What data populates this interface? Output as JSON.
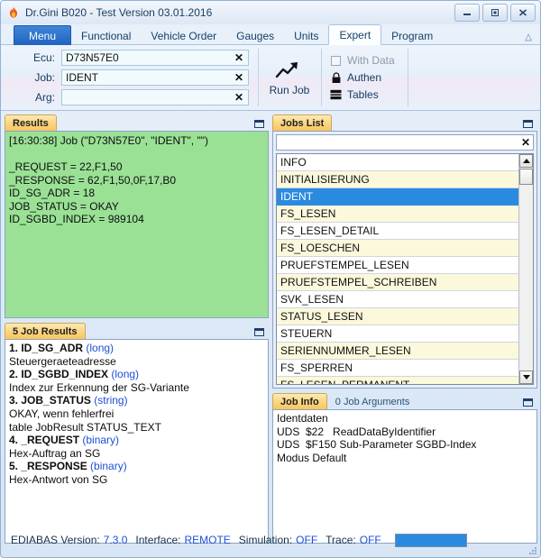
{
  "window": {
    "title": "Dr.Gini B020 - Test Version 03.01.2016",
    "icon": "flame-icon",
    "buttons": {
      "minimize": "minimize-icon",
      "maximize": "maximize-icon",
      "close": "close-icon"
    }
  },
  "ribbon": {
    "menu_label": "Menu",
    "tabs": [
      {
        "label": "Functional",
        "active": false
      },
      {
        "label": "Vehicle Order",
        "active": false
      },
      {
        "label": "Gauges",
        "active": false
      },
      {
        "label": "Units",
        "active": false
      },
      {
        "label": "Expert",
        "active": true
      },
      {
        "label": "Program",
        "active": false
      }
    ],
    "collapse_icon": "chevron-up-icon",
    "fields": [
      {
        "label": "Ecu:",
        "value": "D73N57E0",
        "placeholder": "",
        "clear": "✕"
      },
      {
        "label": "Job:",
        "value": "IDENT",
        "placeholder": "",
        "clear": "✕"
      },
      {
        "label": "Arg:",
        "value": "",
        "placeholder": "",
        "clear": "✕"
      }
    ],
    "run_job": {
      "label": "Run Job",
      "icon": "trend-up-icon"
    },
    "options": [
      {
        "label": "With Data",
        "icon": "checkbox-icon",
        "enabled": false
      },
      {
        "label": "Authen",
        "icon": "lock-icon",
        "enabled": true
      },
      {
        "label": "Tables",
        "icon": "table-icon",
        "enabled": true
      }
    ]
  },
  "results_panel": {
    "title": "Results",
    "restore_icon": "restore-icon",
    "text": "[16:30:38] Job (\"D73N57E0\", \"IDENT\", \"\")\n\n_REQUEST = 22,F1,50\n_RESPONSE = 62,F1,50,0F,17,B0\nID_SG_ADR = 18\nJOB_STATUS = OKAY\nID_SGBD_INDEX = 989104"
  },
  "job_results_panel": {
    "title": "5 Job Results",
    "restore_icon": "restore-icon",
    "entries": [
      {
        "head": "1. ID_SG_ADR",
        "type": "(long)",
        "desc": [
          "Steuergeraeteadresse"
        ]
      },
      {
        "head": "2. ID_SGBD_INDEX",
        "type": "(long)",
        "desc": [
          "Index zur Erkennung der SG-Variante"
        ]
      },
      {
        "head": "3. JOB_STATUS",
        "type": "(string)",
        "desc": [
          "OKAY, wenn fehlerfrei",
          "table JobResult STATUS_TEXT"
        ]
      },
      {
        "head": "4. _REQUEST",
        "type": "(binary)",
        "desc": [
          "Hex-Auftrag an SG"
        ]
      },
      {
        "head": "5. _RESPONSE",
        "type": "(binary)",
        "desc": [
          "Hex-Antwort von SG"
        ]
      }
    ]
  },
  "jobs_list_panel": {
    "title": "Jobs List",
    "restore_icon": "restore-icon",
    "search": {
      "value": "",
      "placeholder": "",
      "clear": "✕"
    },
    "items": [
      {
        "label": "INFO",
        "selected": false
      },
      {
        "label": "INITIALISIERUNG",
        "selected": false
      },
      {
        "label": "IDENT",
        "selected": true
      },
      {
        "label": "FS_LESEN",
        "selected": false
      },
      {
        "label": "FS_LESEN_DETAIL",
        "selected": false
      },
      {
        "label": "FS_LOESCHEN",
        "selected": false
      },
      {
        "label": "PRUEFSTEMPEL_LESEN",
        "selected": false
      },
      {
        "label": "PRUEFSTEMPEL_SCHREIBEN",
        "selected": false
      },
      {
        "label": "SVK_LESEN",
        "selected": false
      },
      {
        "label": "STATUS_LESEN",
        "selected": false
      },
      {
        "label": "STEUERN",
        "selected": false
      },
      {
        "label": "SERIENNUMMER_LESEN",
        "selected": false
      },
      {
        "label": "FS_SPERREN",
        "selected": false
      },
      {
        "label": "FS_LESEN_PERMANENT",
        "selected": false
      }
    ],
    "scrollbar": {
      "up_icon": "arrow-up-icon",
      "down_icon": "arrow-down-icon"
    }
  },
  "job_info_panel": {
    "tabs": [
      {
        "label": "Job Info",
        "active": true
      },
      {
        "label": "0 Job Arguments",
        "active": false
      }
    ],
    "restore_icon": "restore-icon",
    "lines": [
      "Identdaten",
      "UDS  $22   ReadDataByIdentifier",
      "UDS  $F150 Sub-Parameter SGBD-Index",
      "Modus Default"
    ]
  },
  "statusbar": {
    "segments": [
      {
        "label": "EDIABAS Version:",
        "value": "7.3.0"
      },
      {
        "label": "Interface:",
        "value": "REMOTE"
      },
      {
        "label": "Simulation:",
        "value": "OFF"
      },
      {
        "label": "Trace:",
        "value": "OFF"
      }
    ],
    "progress_color": "#2a8ae0"
  }
}
